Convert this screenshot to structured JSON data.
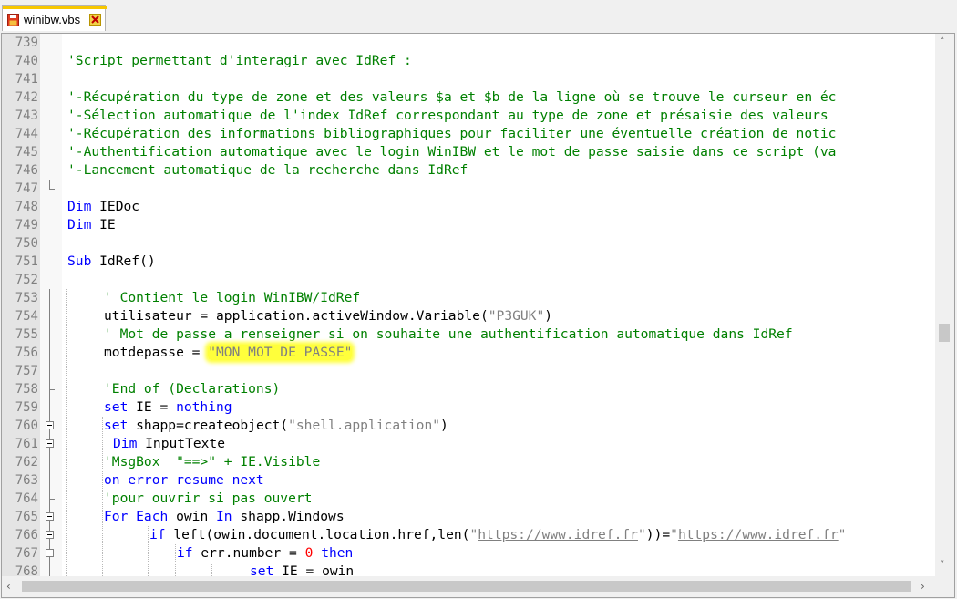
{
  "tab": {
    "label": "winibw.vbs",
    "icon": "floppy-disk-icon",
    "close_icon": "close-icon",
    "accent_color": "#f7c700"
  },
  "editor": {
    "line_numbers": [
      "739",
      "740",
      "741",
      "742",
      "743",
      "744",
      "745",
      "746",
      "747",
      "748",
      "749",
      "750",
      "751",
      "752",
      "753",
      "754",
      "755",
      "756",
      "757",
      "758",
      "759",
      "760",
      "761",
      "762",
      "763",
      "764",
      "765",
      "766",
      "767",
      "768"
    ],
    "lines": [
      "",
      "'Script permettant d'interagir avec IdRef :",
      "",
      "'-Récupération du type de zone et des valeurs $a et $b de la ligne où se trouve le curseur en éc",
      "'-Sélection automatique de l'index IdRef correspondant au type de zone et présaisie des valeurs",
      "'-Récupération des informations bibliographiques pour faciliter une éventuelle création de notic",
      "'-Authentification automatique avec le login WinIBW et le mot de passe saisie dans ce script (va",
      "'-Lancement automatique de la recherche dans IdRef",
      "",
      [
        "Dim",
        " IEDoc"
      ],
      [
        "Dim",
        " IE"
      ],
      "",
      [
        "Sub",
        " IdRef()"
      ],
      "",
      "' Contient le login WinIBW/IdRef",
      [
        "utilisateur = application.activeWindow.Variable(",
        "\"P3GUK\"",
        ")"
      ],
      "' Mot de passe a renseigner si on souhaite une authentification automatique dans IdRef",
      [
        "motdepasse = ",
        "\"MON MOT DE PASSE\""
      ],
      "",
      "'End of (Declarations)",
      [
        "set",
        " IE = ",
        "nothing"
      ],
      [
        "set",
        " shapp=createobject(",
        "\"shell.application\"",
        ")"
      ],
      [
        "Dim",
        " InputTexte"
      ],
      "'MsgBox  \"==>\" + IE.Visible",
      "on error resume next",
      "'pour ouvrir si pas ouvert",
      [
        "For Each",
        " owin ",
        "In",
        " shapp.Windows"
      ],
      [
        "if",
        " left(owin.document.location.href,len(",
        "\"",
        "https://www.idref.fr",
        "\"",
        "))=",
        "\"",
        "https://www.idref.fr",
        "\""
      ],
      [
        "if",
        " err.number = ",
        "0",
        " ",
        "then"
      ],
      [
        "set",
        " IE = owin"
      ]
    ],
    "highlight_color": "#ffff3b"
  },
  "scrollbars": {
    "up_icon": "chevron-up-icon",
    "down_icon": "chevron-down-icon",
    "left_icon": "chevron-left-icon",
    "right_icon": "chevron-right-icon"
  }
}
